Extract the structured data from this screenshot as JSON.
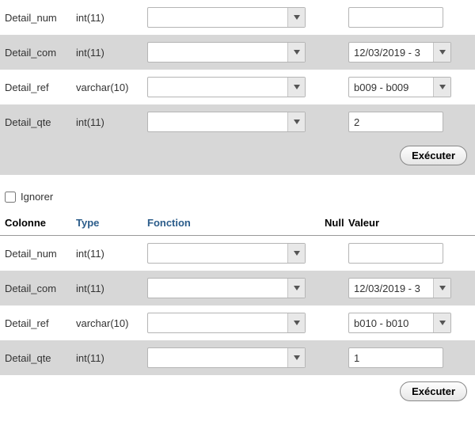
{
  "block1": {
    "rows": [
      {
        "name": "Detail_num",
        "type": "int(11)",
        "func": "",
        "value_kind": "text",
        "value": ""
      },
      {
        "name": "Detail_com",
        "type": "int(11)",
        "func": "",
        "value_kind": "select",
        "value": "12/03/2019 - 3"
      },
      {
        "name": "Detail_ref",
        "type": "varchar(10)",
        "func": "",
        "value_kind": "select",
        "value": "b009 - b009"
      },
      {
        "name": "Detail_qte",
        "type": "int(11)",
        "func": "",
        "value_kind": "text",
        "value": "2"
      }
    ],
    "execute_label": "Exécuter"
  },
  "ignore_label": "Ignorer",
  "headers": {
    "colonne": "Colonne",
    "type": "Type",
    "fonction": "Fonction",
    "null": "Null",
    "valeur": "Valeur"
  },
  "block2": {
    "rows": [
      {
        "name": "Detail_num",
        "type": "int(11)",
        "func": "",
        "value_kind": "text",
        "value": ""
      },
      {
        "name": "Detail_com",
        "type": "int(11)",
        "func": "",
        "value_kind": "select",
        "value": "12/03/2019 - 3"
      },
      {
        "name": "Detail_ref",
        "type": "varchar(10)",
        "func": "",
        "value_kind": "select",
        "value": "b010 - b010"
      },
      {
        "name": "Detail_qte",
        "type": "int(11)",
        "func": "",
        "value_kind": "text",
        "value": "1"
      }
    ],
    "execute_label": "Exécuter"
  }
}
